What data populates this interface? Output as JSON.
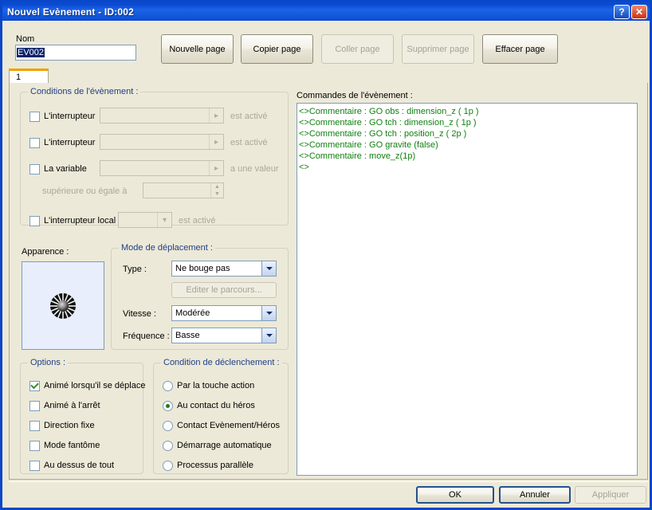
{
  "window": {
    "title": "Nouvel Evènement - ID:002",
    "help_button": "?",
    "close_button": "✕"
  },
  "toolbar": {
    "nom_label": "Nom",
    "nom_value": "EV002",
    "new_page": "Nouvelle page",
    "copy_page": "Copier page",
    "paste_page": "Coller page",
    "delete_page": "Supprimer page",
    "clear_page": "Effacer page"
  },
  "tabs": [
    {
      "label": "1",
      "selected": true
    }
  ],
  "conditions": {
    "title": "Conditions de l'évènement :",
    "rows": [
      {
        "label": "L'interrupteur",
        "checked": false,
        "value": "",
        "suffix": "est activé"
      },
      {
        "label": "L'interrupteur",
        "checked": false,
        "value": "",
        "suffix": "est activé"
      },
      {
        "label": "La variable",
        "checked": false,
        "value": "",
        "suffix": "a une valeur"
      }
    ],
    "comparison_label": "supérieure ou égale à",
    "comparison_value": "",
    "local_switch": {
      "label": "L'interrupteur local",
      "checked": false,
      "value": "",
      "suffix": "est activé"
    }
  },
  "appearance": {
    "label": "Apparence :",
    "sprite": "starburst-sprite"
  },
  "movement": {
    "title": "Mode de déplacement :",
    "type_label": "Type :",
    "type_value": "Ne bouge pas",
    "edit_route_button": "Editer le parcours...",
    "speed_label": "Vitesse :",
    "speed_value": "Modérée",
    "frequency_label": "Fréquence :",
    "frequency_value": "Basse"
  },
  "options": {
    "title": "Options :",
    "items": [
      {
        "label": "Animé lorsqu'il se déplace",
        "checked": true
      },
      {
        "label": "Animé à l'arrêt",
        "checked": false
      },
      {
        "label": "Direction fixe",
        "checked": false
      },
      {
        "label": "Mode fantôme",
        "checked": false
      },
      {
        "label": "Au dessus de tout",
        "checked": false
      }
    ]
  },
  "trigger": {
    "title": "Condition de déclenchement :",
    "items": [
      {
        "label": "Par la touche action",
        "selected": false
      },
      {
        "label": "Au contact du héros",
        "selected": true
      },
      {
        "label": "Contact Evènement/Héros",
        "selected": false
      },
      {
        "label": "Démarrage automatique",
        "selected": false
      },
      {
        "label": "Processus parallèle",
        "selected": false
      }
    ]
  },
  "commands": {
    "label": "Commandes de l'évènement :",
    "lines": [
      "<>Commentaire : GO obs : dimension_z ( 1p )",
      "<>Commentaire : GO tch : dimension_z ( 1p )",
      "<>Commentaire : GO tch : position_z ( 2p )",
      "<>Commentaire : GO gravite (false)",
      "<>Commentaire : move_z(1p)",
      "<>"
    ]
  },
  "footer": {
    "ok": "OK",
    "cancel": "Annuler",
    "apply": "Appliquer"
  },
  "colors": {
    "titlebar": "#0a46c8",
    "dialog_bg": "#ece9d8",
    "group_title": "#1f3f87",
    "command_text": "#128012",
    "selection": "#0a246a",
    "tab_accent": "#f0a000"
  }
}
